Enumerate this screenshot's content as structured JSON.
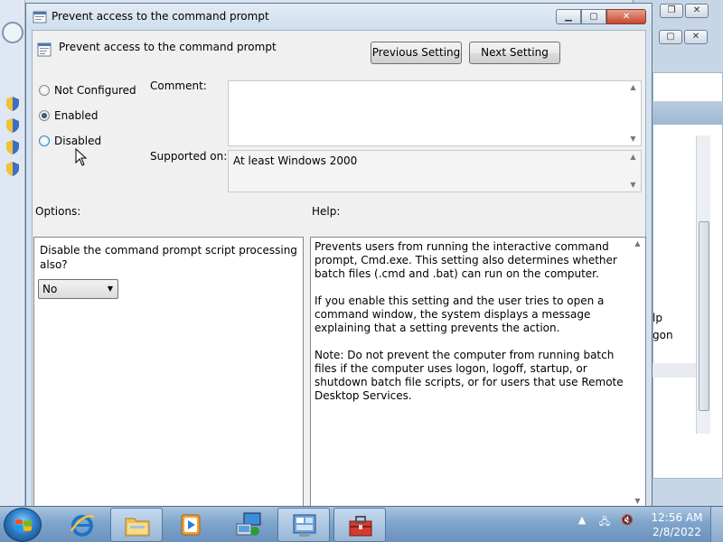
{
  "dialog": {
    "title": "Prevent access to the command prompt",
    "setting_name": "Prevent access to the command prompt",
    "prev_button": "Previous Setting",
    "next_button": "Next Setting",
    "window_buttons": {
      "minimize": "▁",
      "maximize": "▢",
      "close": "✕"
    }
  },
  "state": {
    "options": [
      {
        "label": "Not Configured",
        "checked": false
      },
      {
        "label": "Enabled",
        "checked": true
      },
      {
        "label": "Disabled",
        "checked": false
      }
    ]
  },
  "comment": {
    "label": "Comment:",
    "value": ""
  },
  "supported": {
    "label": "Supported on:",
    "value": "At least Windows 2000"
  },
  "options_panel": {
    "header": "Options:",
    "question": "Disable the command prompt script processing also?",
    "select_value": "No"
  },
  "help_panel": {
    "header": "Help:",
    "paragraphs": [
      "Prevents users from running the interactive command prompt, Cmd.exe. This setting also determines whether batch files (.cmd and .bat) can run on the computer.",
      "If you enable this setting and the user tries to open a command window, the system displays a message explaining that a setting prevents the action.",
      "Note: Do not prevent the computer from running batch files if the computer uses logon, logoff, startup, or shutdown batch file scripts, or for users that use Remote Desktop Services."
    ]
  },
  "background_window": {
    "text_lines": [
      "lp",
      "gon"
    ]
  },
  "taskbar": {
    "items": [
      {
        "name": "internet-explorer",
        "active": false
      },
      {
        "name": "windows-explorer",
        "active": true
      },
      {
        "name": "media-player",
        "active": false
      },
      {
        "name": "network-connections",
        "active": false
      },
      {
        "name": "control-panel",
        "active": true
      },
      {
        "name": "toolbox",
        "active": true
      }
    ],
    "time": "12:56 AM",
    "date": "2/8/2022"
  },
  "colors": {
    "accent": "#3c7fb1",
    "taskbar": "#7fa5cc",
    "close_button": "#c6472f"
  }
}
